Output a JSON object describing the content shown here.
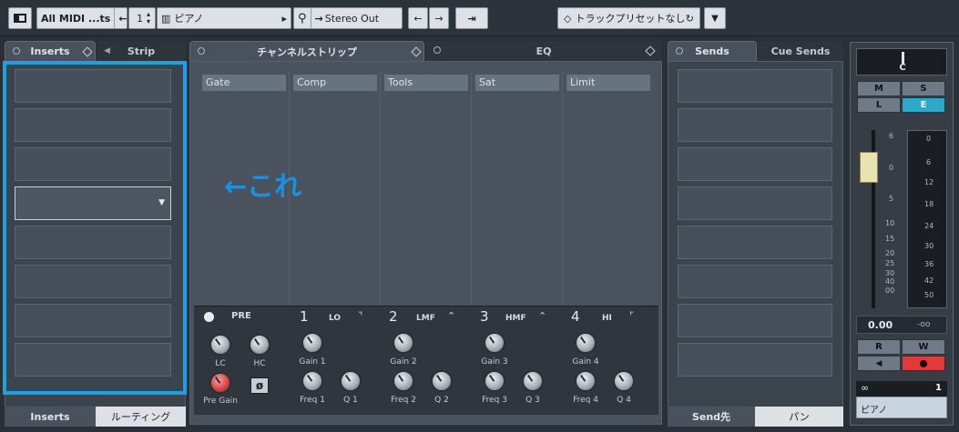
{
  "toolbar": {
    "midi_input": "All MIDI ...ts",
    "channel": "1",
    "instrument": "ピアノ",
    "output": "Stereo Out",
    "preset": "トラックプリセットなし"
  },
  "left_tabs": {
    "inserts": "Inserts",
    "strip": "Strip"
  },
  "left_bottom_tabs": {
    "inserts": "Inserts",
    "routing": "ルーティング"
  },
  "center_tabs": {
    "channel_strip": "チャンネルストリップ",
    "eq": "EQ"
  },
  "modules": [
    "Gate",
    "Comp",
    "Tools",
    "Sat",
    "Limit"
  ],
  "annotation": "←これ",
  "eq": {
    "pre_label": "PRE",
    "lc": "LC",
    "hc": "HC",
    "pre_gain": "Pre Gain",
    "phase_symbol": "ø",
    "bands": [
      {
        "num": "1",
        "name": "LO",
        "gain": "Gain 1",
        "freq": "Freq 1",
        "q": "Q 1",
        "icon": "⌝"
      },
      {
        "num": "2",
        "name": "LMF",
        "gain": "Gain 2",
        "freq": "Freq 2",
        "q": "Q 2",
        "icon": "⌃"
      },
      {
        "num": "3",
        "name": "HMF",
        "gain": "Gain 3",
        "freq": "Freq 3",
        "q": "Q 3",
        "icon": "⌃"
      },
      {
        "num": "4",
        "name": "HI",
        "gain": "Gain 4",
        "freq": "Freq 4",
        "q": "Q 4",
        "icon": "⌜"
      }
    ]
  },
  "right_tabs": {
    "sends": "Sends",
    "cue_sends": "Cue Sends"
  },
  "right_bottom_tabs": {
    "send_dest": "Send先",
    "pan": "パン"
  },
  "channel": {
    "pan": "C",
    "m": "M",
    "s": "S",
    "l": "L",
    "e": "E",
    "volume": "0.00",
    "peak": "-oo",
    "r": "R",
    "w": "W",
    "number": "1",
    "name": "ピアノ"
  },
  "fader_scale": [
    "6",
    "0",
    "5",
    "10",
    "15",
    "20",
    "25",
    "30",
    "40",
    "00"
  ],
  "meter_scale": [
    "0",
    "6",
    "12",
    "18",
    "24",
    "30",
    "36",
    "42",
    "50"
  ],
  "colors": {
    "highlight": "#1da0e4",
    "e_button": "#2fa7c9",
    "record": "#e03a3a"
  }
}
